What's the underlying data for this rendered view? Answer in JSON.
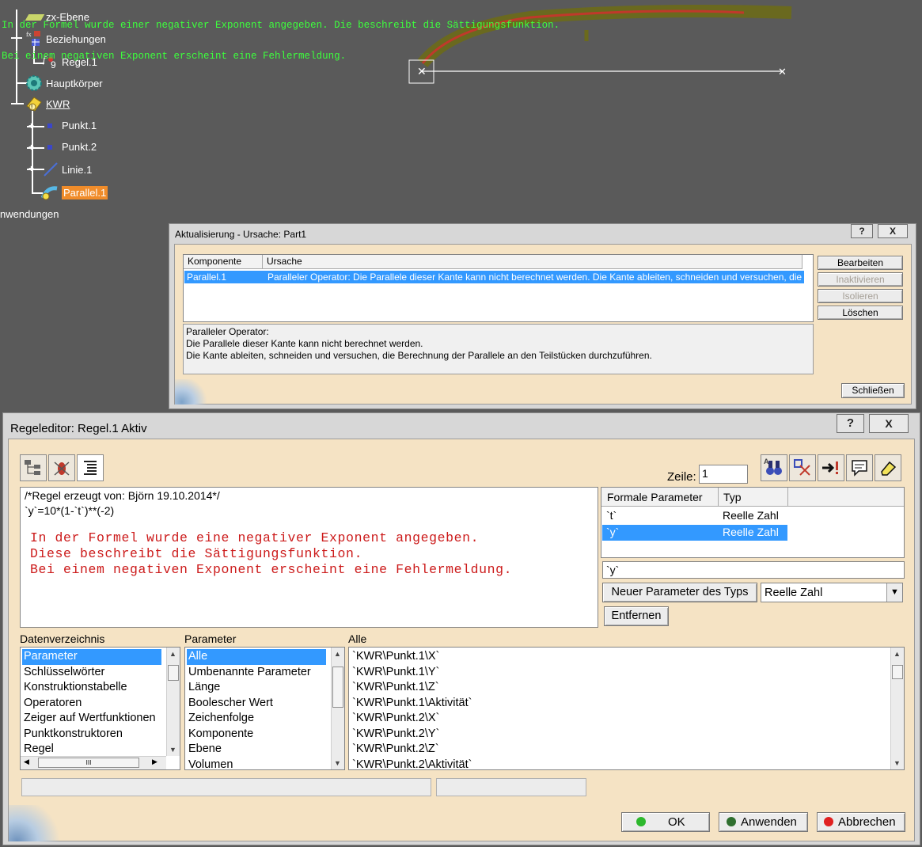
{
  "overlay_note": {
    "line1": "In der Formel wurde einer negativer Exponent angegeben. Die beschreibt die Sättigungsfunktion.",
    "line2": "Bei einem negativen Exponent erscheint eine Fehlermeldung."
  },
  "tree": {
    "items": [
      {
        "label": "zx-Ebene"
      },
      {
        "label": "Beziehungen"
      },
      {
        "label": "Regel.1"
      },
      {
        "label": "Hauptkörper"
      },
      {
        "label": "KWR"
      },
      {
        "label": "Punkt.1"
      },
      {
        "label": "Punkt.2"
      },
      {
        "label": "Linie.1"
      },
      {
        "label": "Parallel.1"
      },
      {
        "label": "nwendungen"
      }
    ]
  },
  "update_dialog": {
    "title": "Aktualisierung - Ursache: Part1",
    "help_label": "?",
    "close_label": "X",
    "columns": [
      "Komponente",
      "Ursache"
    ],
    "rows": [
      {
        "component": "Parallel.1",
        "cause": "Paralleler Operator: Die Parallele dieser Kante kann nicht berechnet werden. Die Kante ableiten, schneiden und versuchen, die ..."
      }
    ],
    "detail_lines": [
      "Paralleler Operator:",
      "Die Parallele dieser Kante kann nicht berechnet werden.",
      "Die Kante ableiten, schneiden und versuchen, die Berechnung der Parallele an den Teilstücken durchzuführen."
    ],
    "buttons": {
      "edit": "Bearbeiten",
      "deactivate": "Inaktivieren",
      "isolate": "Isolieren",
      "delete": "Löschen",
      "close": "Schließen"
    }
  },
  "rule_editor": {
    "title": "Regeleditor: Regel.1 Aktiv",
    "help_label": "?",
    "close_label": "X",
    "line_label": "Zeile:",
    "line_value": "1",
    "code_lines": [
      "/*Regel erzeugt von: Björn 19.10.2014*/",
      "`y`=10*(1-`t`)**(-2)"
    ],
    "comment_lines": [
      "In der Formel wurde eine negativer Exponent angegeben.",
      "Diese beschreibt die Sättigungsfunktion.",
      "Bei einem negativen Exponent erscheint eine Fehlermeldung."
    ],
    "formal_params": {
      "headers": [
        "Formale Parameter",
        "Typ"
      ],
      "rows": [
        {
          "name": "`t`",
          "type": "Reelle Zahl"
        },
        {
          "name": "`y`",
          "type": "Reelle Zahl"
        }
      ],
      "selected_index": 1,
      "name_field": "`y`"
    },
    "new_param_button": "Neuer Parameter des Typs",
    "new_param_type": "Reelle Zahl",
    "remove_button": "Entfernen",
    "lists": {
      "datenverzeichnis": {
        "label": "Datenverzeichnis",
        "items": [
          "Parameter",
          "Schlüsselwörter",
          "Konstruktionstabelle",
          "Operatoren",
          "Zeiger auf Wertfunktionen",
          "Punktkonstruktoren",
          "Regel"
        ],
        "selected": 0
      },
      "parameter": {
        "label": "Parameter",
        "items": [
          "Alle",
          "Umbenannte Parameter",
          "Länge",
          "Boolescher Wert",
          "Zeichenfolge",
          "Komponente",
          "Ebene",
          "Volumen"
        ],
        "selected": 0
      },
      "alle": {
        "label": "Alle",
        "items": [
          "`KWR\\Punkt.1\\X`",
          "`KWR\\Punkt.1\\Y`",
          "`KWR\\Punkt.1\\Z`",
          "`KWR\\Punkt.1\\Aktivität`",
          "`KWR\\Punkt.2\\X`",
          "`KWR\\Punkt.2\\Y`",
          "`KWR\\Punkt.2\\Z`",
          "`KWR\\Punkt.2\\Aktivität`"
        ]
      }
    },
    "buttons": {
      "ok": "OK",
      "apply": "Anwenden",
      "cancel": "Abbrechen"
    },
    "colors": {
      "ok_dot": "#2db82d",
      "apply_dot": "#2f6f2f",
      "cancel_dot": "#e02020"
    }
  }
}
